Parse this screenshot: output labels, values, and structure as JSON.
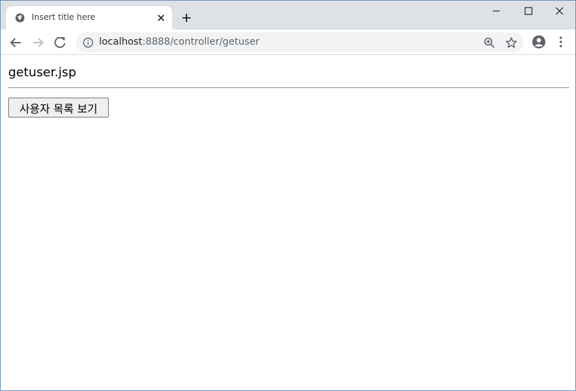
{
  "browser": {
    "tab": {
      "title": "Insert title here"
    },
    "address": {
      "host": "localhost",
      "rest": ":8888/controller/getuser"
    }
  },
  "page": {
    "heading": "getuser.jsp",
    "user_list_button_label": "사용자 목록 보기"
  },
  "colors": {
    "tabstrip_bg": "#dee1e6",
    "omnibox_bg": "#f1f3f4",
    "icon_gray": "#5f6368"
  }
}
